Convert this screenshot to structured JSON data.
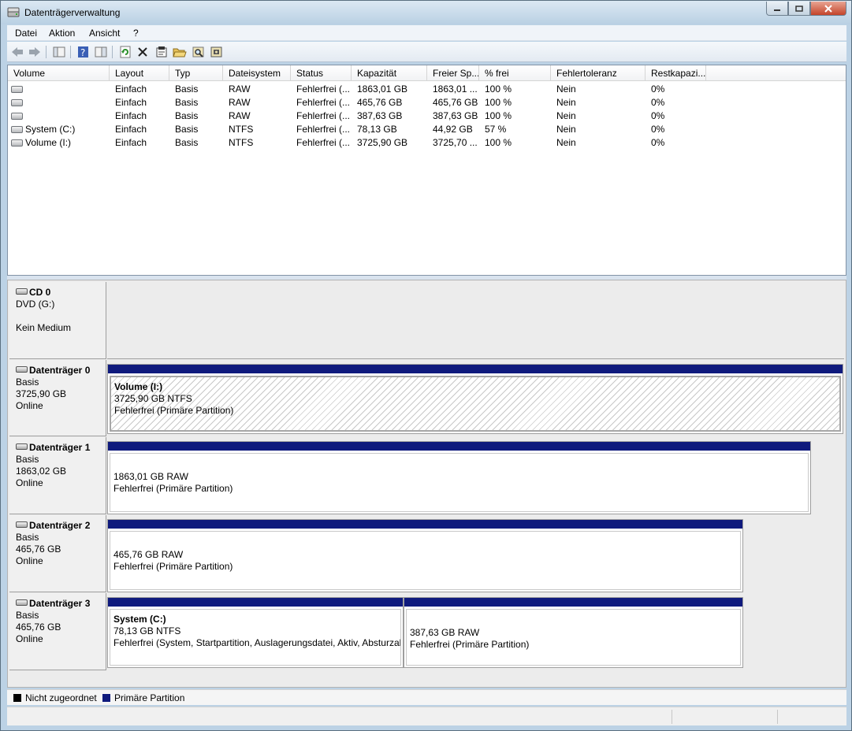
{
  "window": {
    "title": "Datenträgerverwaltung"
  },
  "menu": [
    "Datei",
    "Aktion",
    "Ansicht",
    "?"
  ],
  "toolbar": {
    "buttons": [
      "back-arrow-icon",
      "forward-arrow-icon",
      "console-tree-icon",
      "help-icon",
      "properties-pane-icon",
      "refresh-icon",
      "delete-icon",
      "properties-icon",
      "open-folder-icon",
      "search-icon",
      "disk-settings-icon"
    ]
  },
  "volume_list": {
    "columns": [
      "Volume",
      "Layout",
      "Typ",
      "Dateisystem",
      "Status",
      "Kapazität",
      "Freier Sp...",
      "% frei",
      "Fehlertoleranz",
      "Restkapazi..."
    ],
    "rows": [
      {
        "volume": "",
        "layout": "Einfach",
        "typ": "Basis",
        "fs": "RAW",
        "status": "Fehlerfrei (...",
        "capacity": "1863,01 GB",
        "free": "1863,01 ...",
        "pct": "100 %",
        "fault": "Nein",
        "overhead": "0%"
      },
      {
        "volume": "",
        "layout": "Einfach",
        "typ": "Basis",
        "fs": "RAW",
        "status": "Fehlerfrei (...",
        "capacity": "465,76 GB",
        "free": "465,76 GB",
        "pct": "100 %",
        "fault": "Nein",
        "overhead": "0%"
      },
      {
        "volume": "",
        "layout": "Einfach",
        "typ": "Basis",
        "fs": "RAW",
        "status": "Fehlerfrei (...",
        "capacity": "387,63 GB",
        "free": "387,63 GB",
        "pct": "100 %",
        "fault": "Nein",
        "overhead": "0%"
      },
      {
        "volume": "System (C:)",
        "layout": "Einfach",
        "typ": "Basis",
        "fs": "NTFS",
        "status": "Fehlerfrei (...",
        "capacity": "78,13 GB",
        "free": "44,92 GB",
        "pct": "57 %",
        "fault": "Nein",
        "overhead": "0%"
      },
      {
        "volume": "Volume (I:)",
        "layout": "Einfach",
        "typ": "Basis",
        "fs": "NTFS",
        "status": "Fehlerfrei (...",
        "capacity": "3725,90 GB",
        "free": "3725,70 ...",
        "pct": "100 %",
        "fault": "Nein",
        "overhead": "0%"
      }
    ]
  },
  "disks": [
    {
      "name": "CD 0",
      "line1": "DVD (G:)",
      "line2": "",
      "line3": "Kein Medium"
    },
    {
      "name": "Datenträger 0",
      "line1": "Basis",
      "line2": "3725,90 GB",
      "line3": "Online",
      "partitions": [
        {
          "name": "Volume  (I:)",
          "size": "3725,90 GB NTFS",
          "status": "Fehlerfrei (Primäre Partition)"
        }
      ]
    },
    {
      "name": "Datenträger 1",
      "line1": "Basis",
      "line2": "1863,02 GB",
      "line3": "Online",
      "partitions": [
        {
          "name": "",
          "size": "1863,01 GB RAW",
          "status": "Fehlerfrei (Primäre Partition)"
        }
      ]
    },
    {
      "name": "Datenträger 2",
      "line1": "Basis",
      "line2": "465,76 GB",
      "line3": "Online",
      "partitions": [
        {
          "name": "",
          "size": "465,76 GB RAW",
          "status": "Fehlerfrei (Primäre Partition)"
        }
      ]
    },
    {
      "name": "Datenträger 3",
      "line1": "Basis",
      "line2": "465,76 GB",
      "line3": "Online",
      "partitions": [
        {
          "name": "System  (C:)",
          "size": "78,13 GB NTFS",
          "status": "Fehlerfrei (System, Startpartition, Auslagerungsdatei, Aktiv, Absturzal"
        },
        {
          "name": "",
          "size": "387,63 GB RAW",
          "status": "Fehlerfrei (Primäre Partition)"
        }
      ]
    }
  ],
  "legend": {
    "unallocated": "Nicht zugeordnet",
    "primary": "Primäre Partition",
    "unallocated_color": "#000000",
    "primary_color": "#0f1a7d"
  }
}
